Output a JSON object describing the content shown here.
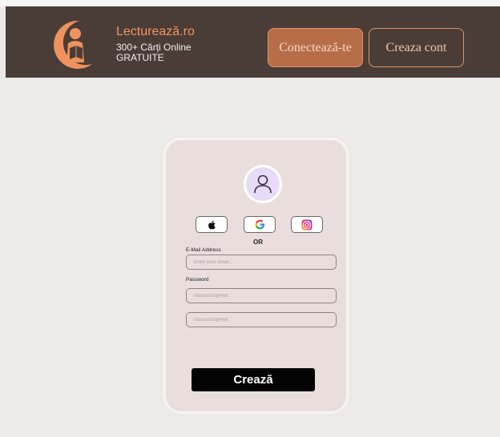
{
  "header": {
    "brand_name": "Lecturează.ro",
    "tagline": "300+ Cărți Online GRATUITE",
    "login_label": "Conectează-te",
    "register_label": "Creaza cont"
  },
  "colors": {
    "header_bg": "#4a3d37",
    "accent": "#f0925e",
    "login_bg": "#b76e48",
    "card_bg": "#eadedd",
    "page_bg": "#ebeae6",
    "submit_bg": "#040404"
  },
  "form": {
    "avatar_icon": "user-icon",
    "social": [
      {
        "name": "apple",
        "icon": "apple-icon"
      },
      {
        "name": "google",
        "icon": "google-icon"
      },
      {
        "name": "instagram",
        "icon": "instagram-icon"
      }
    ],
    "divider_text": "OR",
    "email_label": "E-Mail Address",
    "email_placeholder": "Enter your email...",
    "password_label": "Password",
    "password_placeholder": "Password@456",
    "confirm_placeholder": "Password@456",
    "submit_label": "Crează"
  }
}
